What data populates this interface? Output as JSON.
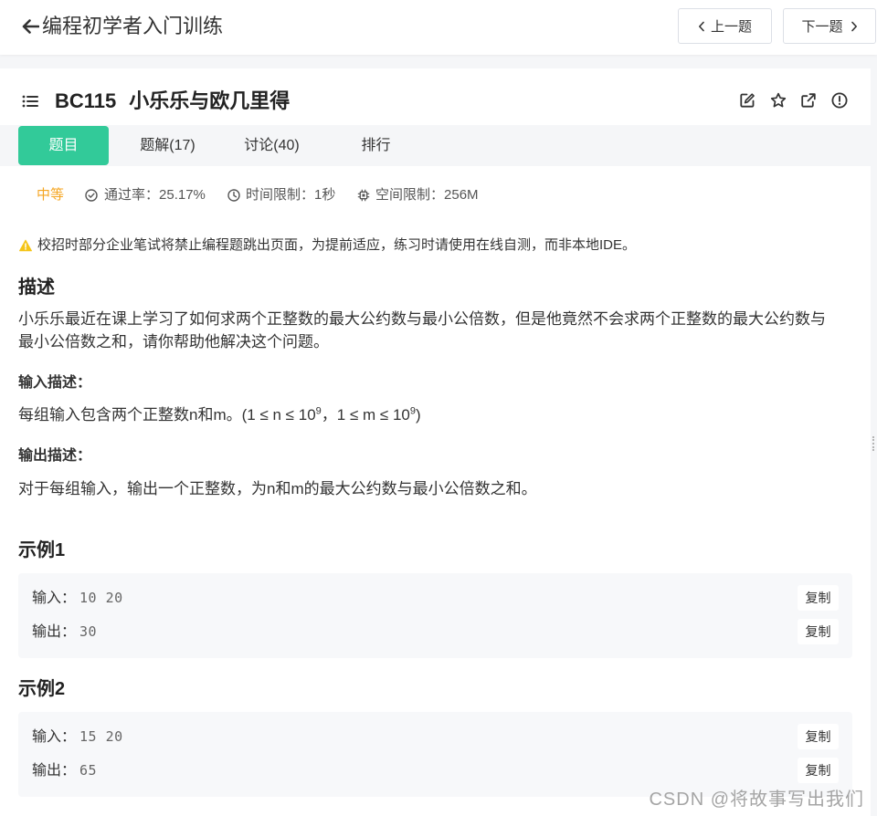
{
  "colors": {
    "accent": "#32ca99",
    "difficulty": "#f5a623",
    "warning": "#f5c518",
    "text": "#333333"
  },
  "header": {
    "back_icon": "arrow-left-icon",
    "title": "编程初学者入门训练",
    "prev": {
      "label": "上一题",
      "icon": "chevron-left-icon"
    },
    "next": {
      "label": "下一题",
      "icon": "chevron-right-icon"
    }
  },
  "problem": {
    "icon": "list-icon",
    "id": "BC115",
    "name": "小乐乐与欧几里得",
    "actions": [
      "edit-icon",
      "star-icon",
      "external-link-icon",
      "alert-circle-icon"
    ]
  },
  "tabs": [
    {
      "label": "题目",
      "active": true
    },
    {
      "label": "题解(17)",
      "active": false
    },
    {
      "label": "讨论(40)",
      "active": false
    },
    {
      "label": "排行",
      "active": false
    }
  ],
  "meta": {
    "difficulty": "中等",
    "pass_rate": {
      "icon": "check-circle-icon",
      "label": "通过率：",
      "value": "25.17%"
    },
    "time_limit": {
      "icon": "clock-icon",
      "label": "时间限制：",
      "value": "1秒"
    },
    "memory_limit": {
      "icon": "chip-icon",
      "label": "空间限制：",
      "value": "256M"
    }
  },
  "notice": {
    "icon": "warning-icon",
    "text": "校招时部分企业笔试将禁止编程题跳出页面，为提前适应，练习时请使用在线自测，而非本地IDE。"
  },
  "description": {
    "heading": "描述",
    "text": "小乐乐最近在课上学习了如何求两个正整数的最大公约数与最小公倍数，但是他竟然不会求两个正整数的最大公约数与最小公倍数之和，请你帮助他解决这个问题。"
  },
  "input_desc": {
    "heading": "输入描述：",
    "text_before": "每组输入包含两个正整数n和m。(1 ≤ n ≤ 10",
    "exp_n": "9",
    "text_middle": "，1 ≤ m ≤ 10",
    "exp_m": "9",
    "text_after": ")"
  },
  "output_desc": {
    "heading": "输出描述：",
    "text": "对于每组输入，输出一个正整数，为n和m的最大公约数与最小公倍数之和。"
  },
  "copy_label": "复制",
  "examples": [
    {
      "heading": "示例1",
      "input_label": "输入：",
      "input": "10 20",
      "output_label": "输出：",
      "output": "30"
    },
    {
      "heading": "示例2",
      "input_label": "输入：",
      "input": "15 20",
      "output_label": "输出：",
      "output": "65"
    }
  ],
  "watermark": "CSDN @将故事写出我们"
}
